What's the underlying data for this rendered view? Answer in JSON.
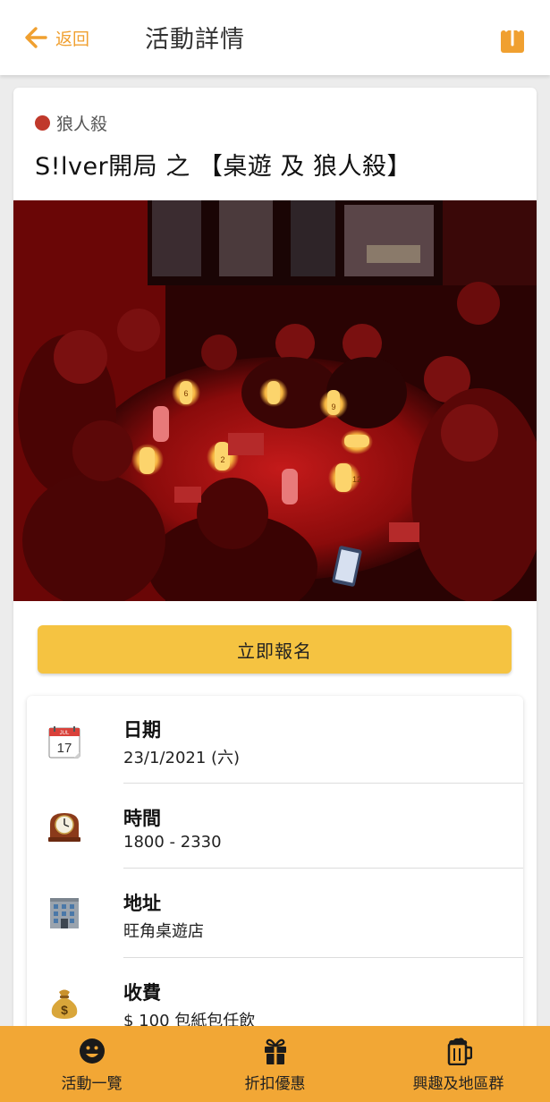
{
  "header": {
    "back_label": "返回",
    "title": "活動詳情",
    "accent": "#f0a030"
  },
  "event": {
    "category": "狼人殺",
    "category_color": "#c0392b",
    "title": "S!lver開局 之 【桌遊 及 狼人殺】",
    "signup_label": "立即報名"
  },
  "details": {
    "date_label": "日期",
    "date_value": "23/1/2021 (六)",
    "date_icon_month": "JUL",
    "date_icon_day": "17",
    "time_label": "時間",
    "time_value": "1800 - 2330",
    "address_label": "地址",
    "address_value": "旺角桌遊店",
    "fee_label": "收費",
    "fee_value": "$ 100 包紙包任飲",
    "fee_icon_glyph": "$"
  },
  "photo_lantern_numbers": [
    "6",
    "9",
    "2",
    "12"
  ],
  "nav": {
    "items": [
      {
        "label": "活動一覽",
        "icon": "smiley-icon"
      },
      {
        "label": "折扣優惠",
        "icon": "gift-icon"
      },
      {
        "label": "興趣及地區群",
        "icon": "beer-mug-icon"
      }
    ],
    "background": "#f2a735"
  }
}
